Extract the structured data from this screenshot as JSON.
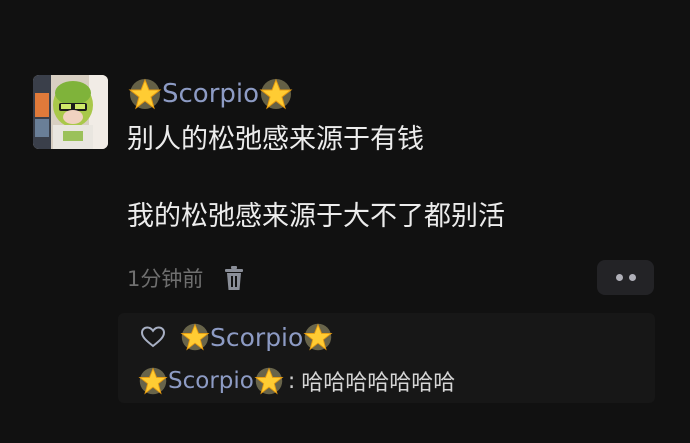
{
  "comment": {
    "avatar_icon": "avatar-girl-green-beanie",
    "username": "Scorpio",
    "username_prefix_icon": "star-emoji",
    "username_suffix_icon": "star-emoji",
    "username_color": "#8d9bc4",
    "content_line1": "别人的松弛感来源于有钱",
    "content_line2": "我的松弛感来源于大不了都别活",
    "time": "1分钟前",
    "delete_icon": "trash-icon",
    "more_icon": "more-dots-icon"
  },
  "reply_panel": {
    "like_icon": "heart-outline-icon",
    "liked_by": "Scorpio",
    "reply_user": "Scorpio",
    "reply_separator": ":",
    "reply_text": "哈哈哈哈哈哈哈"
  },
  "colors": {
    "background": "#111111",
    "panel": "#171717",
    "button": "#232326",
    "text": "#ececec",
    "muted": "#6f6f6f"
  }
}
